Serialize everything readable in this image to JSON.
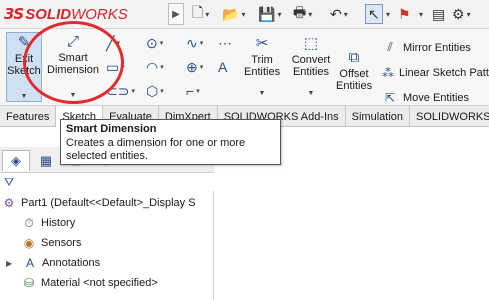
{
  "app": {
    "logo_mark": "3S",
    "logo_solid": "SOLID",
    "logo_works": "WORKS"
  },
  "quick_access": [
    {
      "icon": "new-document-icon",
      "glyph": "🗋"
    },
    {
      "icon": "open-folder-icon",
      "glyph": "📂"
    },
    {
      "icon": "save-icon",
      "glyph": "💾"
    },
    {
      "icon": "print-icon",
      "glyph": "🖶"
    },
    {
      "icon": "undo-icon",
      "glyph": "↶"
    },
    {
      "icon": "select-pointer-icon",
      "glyph": "↖"
    },
    {
      "icon": "rebuild-traffic-light-icon",
      "glyph": "⚑"
    },
    {
      "icon": "file-properties-icon",
      "glyph": "▤"
    },
    {
      "icon": "options-gear-icon",
      "glyph": "⚙"
    }
  ],
  "ribbon": {
    "edit_sketch_line1": "Exit",
    "edit_sketch_line2": "Sketch",
    "smart_dimension_line1": "Smart",
    "smart_dimension_line2": "Dimension",
    "trim_line1": "Trim",
    "trim_line2": "Entities",
    "convert_line1": "Convert",
    "convert_line2": "Entities",
    "offset_line1": "Offset",
    "offset_line2": "Entities",
    "mirror_entities": "Mirror Entities",
    "linear_sketch_pattern": "Linear Sketch Patte",
    "move_entities": "Move Entities"
  },
  "tabs": [
    {
      "label": "Features",
      "active": false
    },
    {
      "label": "Sketch",
      "active": true
    },
    {
      "label": "Evaluate",
      "active": false
    },
    {
      "label": "DimXpert",
      "active": false
    },
    {
      "label": "SOLIDWORKS Add-Ins",
      "active": false
    },
    {
      "label": "Simulation",
      "active": false
    },
    {
      "label": "SOLIDWORKS M",
      "active": false
    }
  ],
  "tooltip": {
    "title": "Smart Dimension",
    "description": "Creates a dimension for one or more selected entities."
  },
  "feature_tree": {
    "root": "Part1  (Default<<Default>_Display S",
    "items": [
      {
        "label": "History",
        "icon": "history-icon"
      },
      {
        "label": "Sensors",
        "icon": "sensors-icon"
      },
      {
        "label": "Annotations",
        "icon": "annotations-icon"
      },
      {
        "label": "Material <not specified>",
        "icon": "material-icon"
      }
    ]
  },
  "colors": {
    "highlight_circle": "#e12b2f",
    "brand_red": "#d0262c",
    "icon_blue": "#2a4f86"
  }
}
